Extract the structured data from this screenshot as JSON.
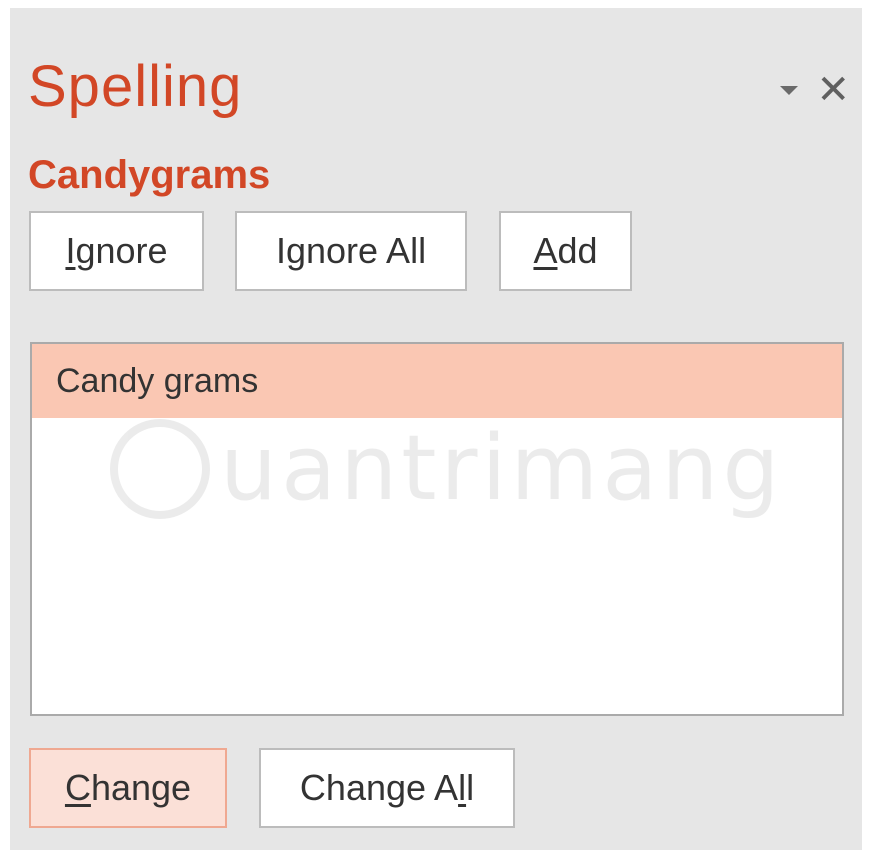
{
  "pane": {
    "title": "Spelling",
    "misspelled_word": "Candygrams",
    "colors": {
      "accent": "#d24726",
      "selected_suggestion": "#fac7b3",
      "default_button": "#fbe0d7"
    }
  },
  "controls": {
    "options_icon": "caret-down-icon",
    "close_icon": "close-icon",
    "close_glyph": "✕"
  },
  "buttons": {
    "ignore": {
      "mnemonic": "I",
      "rest": "gnore"
    },
    "ignore_all": {
      "pre": "I",
      "mnemonic": "g",
      "rest": "nore All"
    },
    "add": {
      "mnemonic": "A",
      "rest": "dd"
    },
    "change": {
      "mnemonic": "C",
      "rest": "hange"
    },
    "change_all": {
      "pre": "Change A",
      "mnemonic": "l",
      "rest": "l"
    }
  },
  "suggestions": [
    {
      "label": "Candy grams",
      "selected": true
    }
  ],
  "watermark": {
    "text": "uantrimang"
  }
}
